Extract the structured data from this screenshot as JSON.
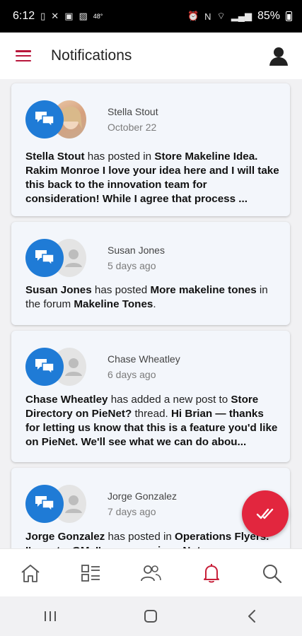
{
  "status_bar": {
    "time": "6:12",
    "temp": "48°",
    "battery": "85%"
  },
  "header": {
    "title": "Notifications"
  },
  "notifications": [
    {
      "author": "Stella Stout",
      "date": "October 22",
      "parts": [
        {
          "t": "Stella Stout",
          "b": true
        },
        {
          "t": " has posted in ",
          "b": false
        },
        {
          "t": "Store  Makeline Idea.",
          "b": true
        },
        {
          "t": " ",
          "b": false
        },
        {
          "t": "Rakim Monroe  I love your idea here and I will take this back to the innovation team for consideration!  While I agree that process ...",
          "b": true
        }
      ]
    },
    {
      "author": "Susan Jones",
      "date": "5 days ago",
      "parts": [
        {
          "t": "Susan Jones",
          "b": true
        },
        {
          "t": " has posted ",
          "b": false
        },
        {
          "t": "More makeline tones",
          "b": true
        },
        {
          "t": " in the forum ",
          "b": false
        },
        {
          "t": "Makeline Tones",
          "b": true
        },
        {
          "t": ".",
          "b": false
        }
      ]
    },
    {
      "author": "Chase Wheatley",
      "date": "6 days ago",
      "parts": [
        {
          "t": "Chase Wheatley",
          "b": true
        },
        {
          "t": " has added a new post to ",
          "b": false
        },
        {
          "t": "Store Directory on PieNet?",
          "b": true
        },
        {
          "t": " thread. ",
          "b": false
        },
        {
          "t": "Hi Brian — thanks for letting us know that this is a feature you'd like on PieNet. We'll see what we can do abou...",
          "b": true
        }
      ]
    },
    {
      "author": "Jorge Gonzalez",
      "date": "7 days ago",
      "parts": [
        {
          "t": "Jorge Gonzalez",
          "b": true
        },
        {
          "t": "  has posted in ",
          "b": false
        },
        {
          "t": "Operations Flyers. I'm not a GM, I'm a supervisor. Not",
          "b": true
        }
      ]
    }
  ],
  "bottom_nav": [
    "home-icon",
    "list-icon",
    "people-icon",
    "bell-icon",
    "search-icon"
  ],
  "colors": {
    "accent": "#e2263e",
    "menu": "#b8163b",
    "bubble": "#1f7bd6"
  }
}
